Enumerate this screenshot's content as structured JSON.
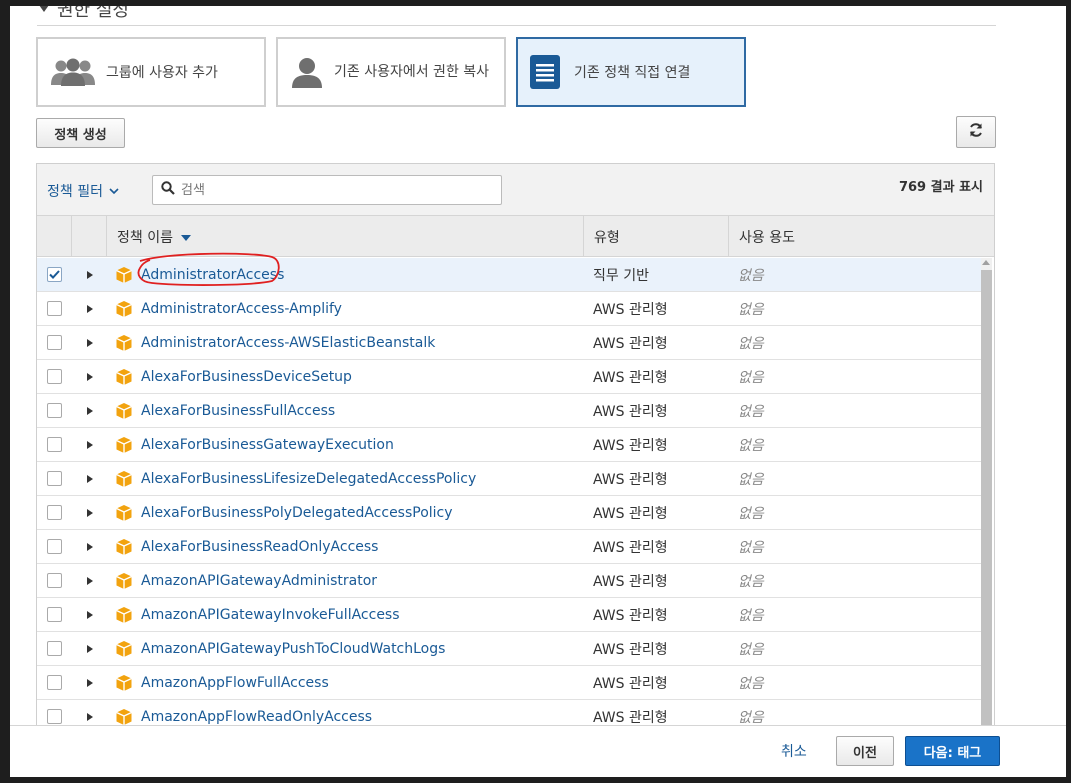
{
  "section": {
    "title": "권한 설정"
  },
  "options": [
    {
      "label": "그룹에 사용자 추가",
      "icon": "users-group-icon",
      "selected": false
    },
    {
      "label": "기존 사용자에서 권한 복사",
      "icon": "user-icon",
      "selected": false
    },
    {
      "label": "기존 정책 직접 연결",
      "icon": "document-icon",
      "selected": true
    }
  ],
  "toolbar": {
    "create_policy_label": "정책 생성",
    "refresh_icon": "refresh-icon"
  },
  "filter": {
    "label": "정책 필터",
    "search_placeholder": "검색",
    "search_value": "",
    "result_count": "769 결과 표시"
  },
  "columns": {
    "name": "정책 이름",
    "type": "유형",
    "usage": "사용 용도"
  },
  "policies": [
    {
      "name": "AdministratorAccess",
      "type": "직무 기반",
      "usage": "없음",
      "checked": true
    },
    {
      "name": "AdministratorAccess-Amplify",
      "type": "AWS 관리형",
      "usage": "없음",
      "checked": false
    },
    {
      "name": "AdministratorAccess-AWSElasticBeanstalk",
      "type": "AWS 관리형",
      "usage": "없음",
      "checked": false
    },
    {
      "name": "AlexaForBusinessDeviceSetup",
      "type": "AWS 관리형",
      "usage": "없음",
      "checked": false
    },
    {
      "name": "AlexaForBusinessFullAccess",
      "type": "AWS 관리형",
      "usage": "없음",
      "checked": false
    },
    {
      "name": "AlexaForBusinessGatewayExecution",
      "type": "AWS 관리형",
      "usage": "없음",
      "checked": false
    },
    {
      "name": "AlexaForBusinessLifesizeDelegatedAccessPolicy",
      "type": "AWS 관리형",
      "usage": "없음",
      "checked": false
    },
    {
      "name": "AlexaForBusinessPolyDelegatedAccessPolicy",
      "type": "AWS 관리형",
      "usage": "없음",
      "checked": false
    },
    {
      "name": "AlexaForBusinessReadOnlyAccess",
      "type": "AWS 관리형",
      "usage": "없음",
      "checked": false
    },
    {
      "name": "AmazonAPIGatewayAdministrator",
      "type": "AWS 관리형",
      "usage": "없음",
      "checked": false
    },
    {
      "name": "AmazonAPIGatewayInvokeFullAccess",
      "type": "AWS 관리형",
      "usage": "없음",
      "checked": false
    },
    {
      "name": "AmazonAPIGatewayPushToCloudWatchLogs",
      "type": "AWS 관리형",
      "usage": "없음",
      "checked": false
    },
    {
      "name": "AmazonAppFlowFullAccess",
      "type": "AWS 관리형",
      "usage": "없음",
      "checked": false
    },
    {
      "name": "AmazonAppFlowReadOnlyAccess",
      "type": "AWS 관리형",
      "usage": "없음",
      "checked": false
    }
  ],
  "footer": {
    "cancel_label": "취소",
    "prev_label": "이전",
    "next_label": "다음: 태그"
  },
  "colors": {
    "link": "#1a5a96",
    "primary": "#1a73c8",
    "selected_card_bg": "#e6f1fb",
    "annotation": "#e02020",
    "package": "#f2a30f"
  }
}
